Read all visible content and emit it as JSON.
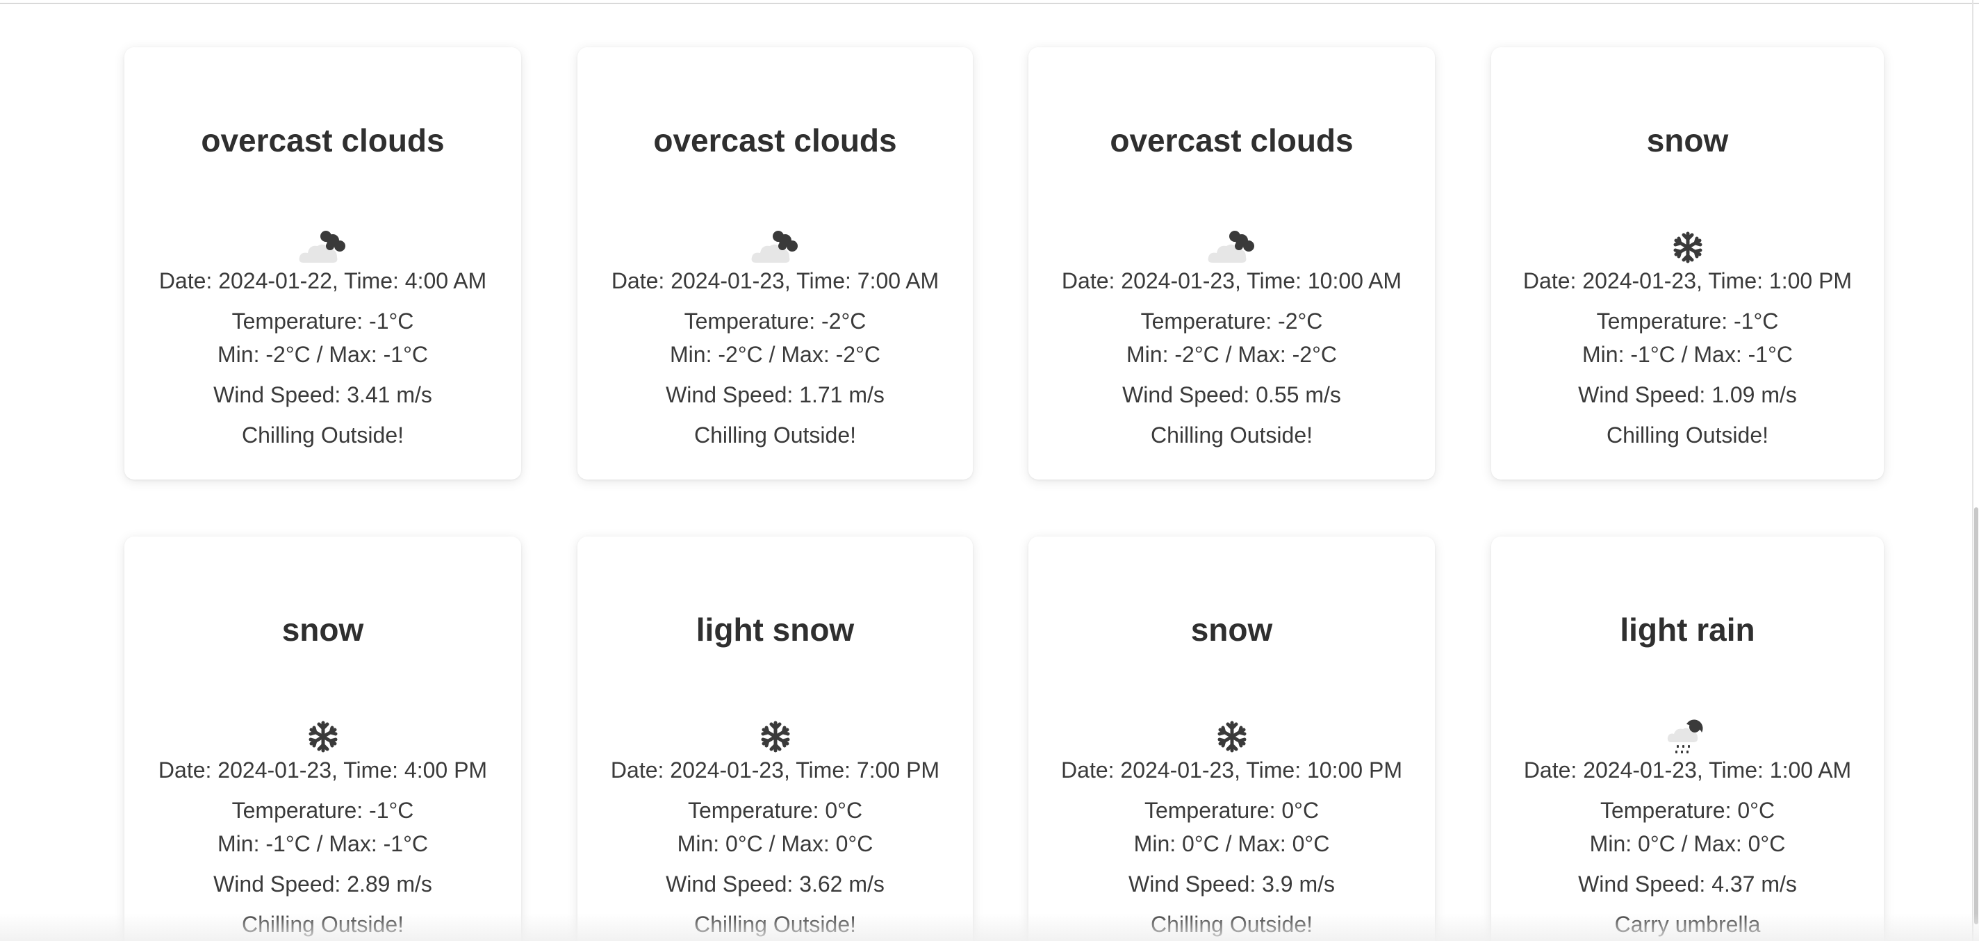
{
  "cards": [
    {
      "description": "overcast clouds",
      "icon": "overcast-clouds-icon",
      "datetime": "Date: 2024-01-22, Time: 4:00 AM",
      "temperature": "Temperature: -1°C",
      "minmax": "Min: -2°C / Max: -1°C",
      "wind": "Wind Speed: 3.41 m/s",
      "advice": "Chilling Outside!"
    },
    {
      "description": "overcast clouds",
      "icon": "overcast-clouds-icon",
      "datetime": "Date: 2024-01-23, Time: 7:00 AM",
      "temperature": "Temperature: -2°C",
      "minmax": "Min: -2°C / Max: -2°C",
      "wind": "Wind Speed: 1.71 m/s",
      "advice": "Chilling Outside!"
    },
    {
      "description": "overcast clouds",
      "icon": "overcast-clouds-icon",
      "datetime": "Date: 2024-01-23, Time: 10:00 AM",
      "temperature": "Temperature: -2°C",
      "minmax": "Min: -2°C / Max: -2°C",
      "wind": "Wind Speed: 0.55 m/s",
      "advice": "Chilling Outside!"
    },
    {
      "description": "snow",
      "icon": "snowflake-icon",
      "datetime": "Date: 2024-01-23, Time: 1:00 PM",
      "temperature": "Temperature: -1°C",
      "minmax": "Min: -1°C / Max: -1°C",
      "wind": "Wind Speed: 1.09 m/s",
      "advice": "Chilling Outside!"
    },
    {
      "description": "snow",
      "icon": "snowflake-icon",
      "datetime": "Date: 2024-01-23, Time: 4:00 PM",
      "temperature": "Temperature: -1°C",
      "minmax": "Min: -1°C / Max: -1°C",
      "wind": "Wind Speed: 2.89 m/s",
      "advice": "Chilling Outside!"
    },
    {
      "description": "light snow",
      "icon": "snowflake-icon",
      "datetime": "Date: 2024-01-23, Time: 7:00 PM",
      "temperature": "Temperature: 0°C",
      "minmax": "Min: 0°C / Max: 0°C",
      "wind": "Wind Speed: 3.62 m/s",
      "advice": "Chilling Outside!"
    },
    {
      "description": "snow",
      "icon": "snowflake-icon",
      "datetime": "Date: 2024-01-23, Time: 10:00 PM",
      "temperature": "Temperature: 0°C",
      "minmax": "Min: 0°C / Max: 0°C",
      "wind": "Wind Speed: 3.9 m/s",
      "advice": "Chilling Outside!"
    },
    {
      "description": "light rain",
      "icon": "light-rain-icon",
      "datetime": "Date: 2024-01-23, Time: 1:00 AM",
      "temperature": "Temperature: 0°C",
      "minmax": "Min: 0°C / Max: 0°C",
      "wind": "Wind Speed: 4.37 m/s",
      "advice": "Carry umbrella"
    }
  ],
  "colors": {
    "text": "#333333",
    "card_background": "#ffffff",
    "page_background": "#ffffff",
    "icon_dark": "#3a3a3a",
    "icon_light": "#e6e6e6"
  }
}
